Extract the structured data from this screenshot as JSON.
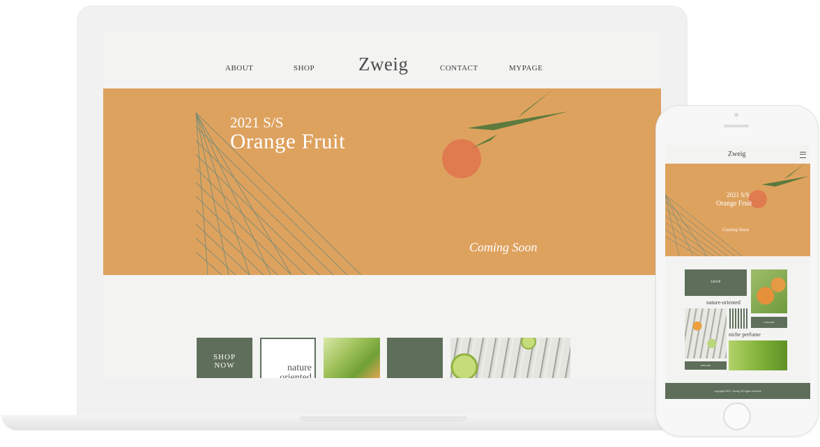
{
  "desktop": {
    "nav": {
      "about": "ABOUT",
      "shop": "SHOP",
      "logo": "Zweig",
      "contact": "CONTACT",
      "mypage": "MYPAGE"
    },
    "hero": {
      "season": "2021 S/S",
      "title": "Orange Fruit",
      "coming": "Coming Soon"
    },
    "tiles": {
      "shop_line1": "SHOP",
      "shop_line2": "NOW",
      "nature_line1": "nature",
      "nature_line2": "oriented"
    }
  },
  "mobile": {
    "logo": "Zweig",
    "hero": {
      "season": "2021 S/S",
      "title": "Orange Fruit",
      "coming": "Coming Soon"
    },
    "shop": "SHOP",
    "nature": "nature-oriented",
    "concept": "CONCEPT",
    "niche": "niche perfume",
    "offline": "OFFLINE",
    "footer": "copyright 2021. Zweig. all rights reserved."
  },
  "colors": {
    "hero_orange": "#dea25f",
    "accent_green": "#5e6e5a",
    "fruit": "#e07a4f",
    "leaf": "#5c7a3d"
  },
  "icons": {
    "menu": "hamburger-icon"
  }
}
